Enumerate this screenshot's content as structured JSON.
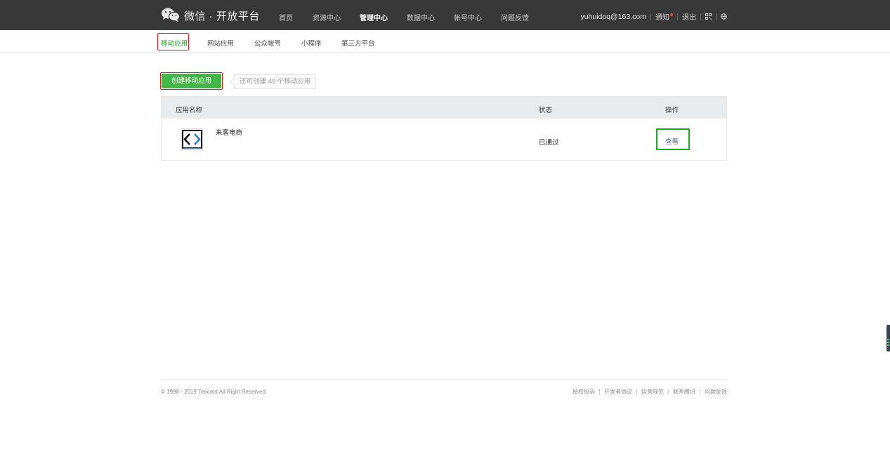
{
  "header": {
    "brand": "微信 · 开放平台",
    "nav": [
      {
        "label": "首页",
        "active": false
      },
      {
        "label": "资源中心",
        "active": false
      },
      {
        "label": "管理中心",
        "active": true
      },
      {
        "label": "数据中心",
        "active": false
      },
      {
        "label": "帐号中心",
        "active": false
      },
      {
        "label": "问题反馈",
        "active": false
      }
    ],
    "user_email": "yuhuidoq@163.com",
    "notify_label": "通知",
    "logout_label": "退出",
    "icons": [
      "qr-code-icon",
      "globe-icon"
    ]
  },
  "subnav": {
    "tabs": [
      {
        "label": "移动应用",
        "active": true
      },
      {
        "label": "网站应用",
        "active": false
      },
      {
        "label": "公众帐号",
        "active": false
      },
      {
        "label": "小程序",
        "active": false
      },
      {
        "label": "第三方平台",
        "active": false
      }
    ]
  },
  "main": {
    "create_button_label": "创建移动应用",
    "remaining_tip": "还可创建 49 个移动应用",
    "table": {
      "columns": [
        "应用名称",
        "状态",
        "操作"
      ],
      "rows": [
        {
          "name": "来客电商",
          "status": "已通过",
          "action": "查看"
        }
      ]
    }
  },
  "footer": {
    "copyright": "© 1998 - 2019 Tencent All Right Reserved.",
    "links": [
      "授权投诉",
      "开发者协议",
      "运营规范",
      "联系腾讯",
      "问题反馈"
    ]
  },
  "colors": {
    "topbar_bg": "#383838",
    "accent_green": "#1aad19",
    "button_green": "#44b549",
    "highlight_red": "#e02020",
    "link_blue": "#576b95"
  }
}
